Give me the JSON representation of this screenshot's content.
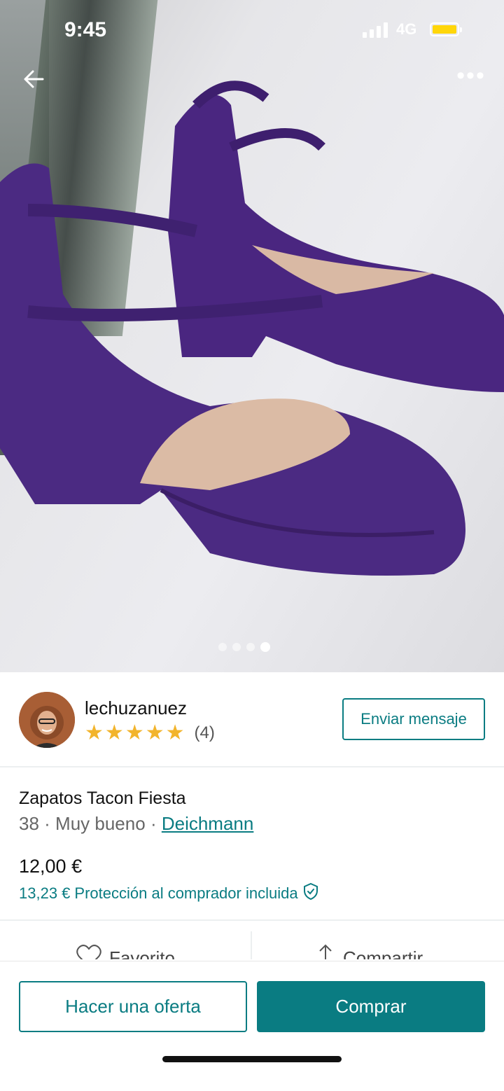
{
  "status": {
    "time": "9:45",
    "network": "4G"
  },
  "seller": {
    "username": "lechuzanuez",
    "rating_stars": 5,
    "review_count": "(4)",
    "message_button": "Enviar mensaje"
  },
  "product": {
    "title": "Zapatos Tacon Fiesta",
    "size": "38",
    "condition": "Muy bueno",
    "brand": "Deichmann",
    "price": "12,00 €",
    "price_with_protection": "13,23 €",
    "protection_text": "Protección al comprador incluida"
  },
  "gallery": {
    "total_images": 4,
    "active_index": 3
  },
  "actions": {
    "favorite": "Favorito",
    "share": "Compartir"
  },
  "bottom": {
    "offer_button": "Hacer una oferta",
    "buy_button": "Comprar"
  },
  "colors": {
    "accent": "#0a7c82",
    "star": "#f2b42c",
    "shoe": "#4b2a82"
  }
}
